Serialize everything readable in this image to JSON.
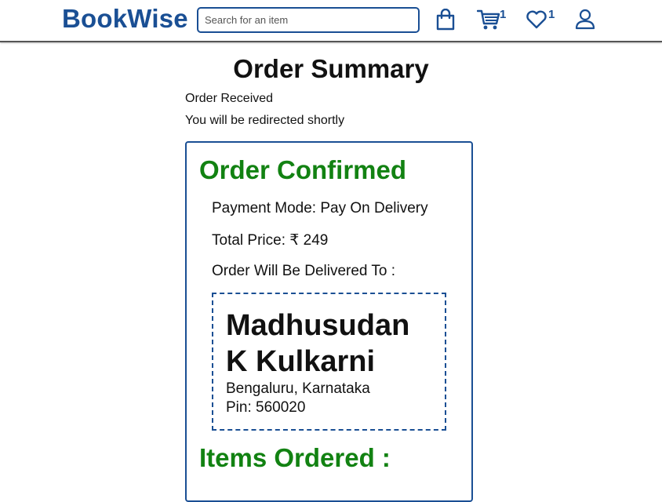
{
  "header": {
    "logo": "BookWise",
    "search_placeholder": "Search for an item",
    "cart_count": "1",
    "wishlist_count": "1"
  },
  "page": {
    "title": "Order Summary",
    "status": "Order Received",
    "redirect_notice": "You will be redirected shortly"
  },
  "order": {
    "heading": "Order Confirmed",
    "payment_mode": "Payment Mode: Pay On Delivery",
    "total_price": "Total Price: ₹ 249",
    "delivery_label": "Order Will Be Delivered To :",
    "address": {
      "name": "Madhusudan K Kulkarni",
      "city_state": "Bengaluru, Karnataka",
      "pin": "Pin: 560020"
    },
    "items_heading": "Items Ordered :"
  },
  "colors": {
    "brand": "#1a4f94",
    "success": "#128212"
  },
  "icons": [
    "shopping-bag-icon",
    "cart-icon",
    "heart-icon",
    "user-icon"
  ]
}
